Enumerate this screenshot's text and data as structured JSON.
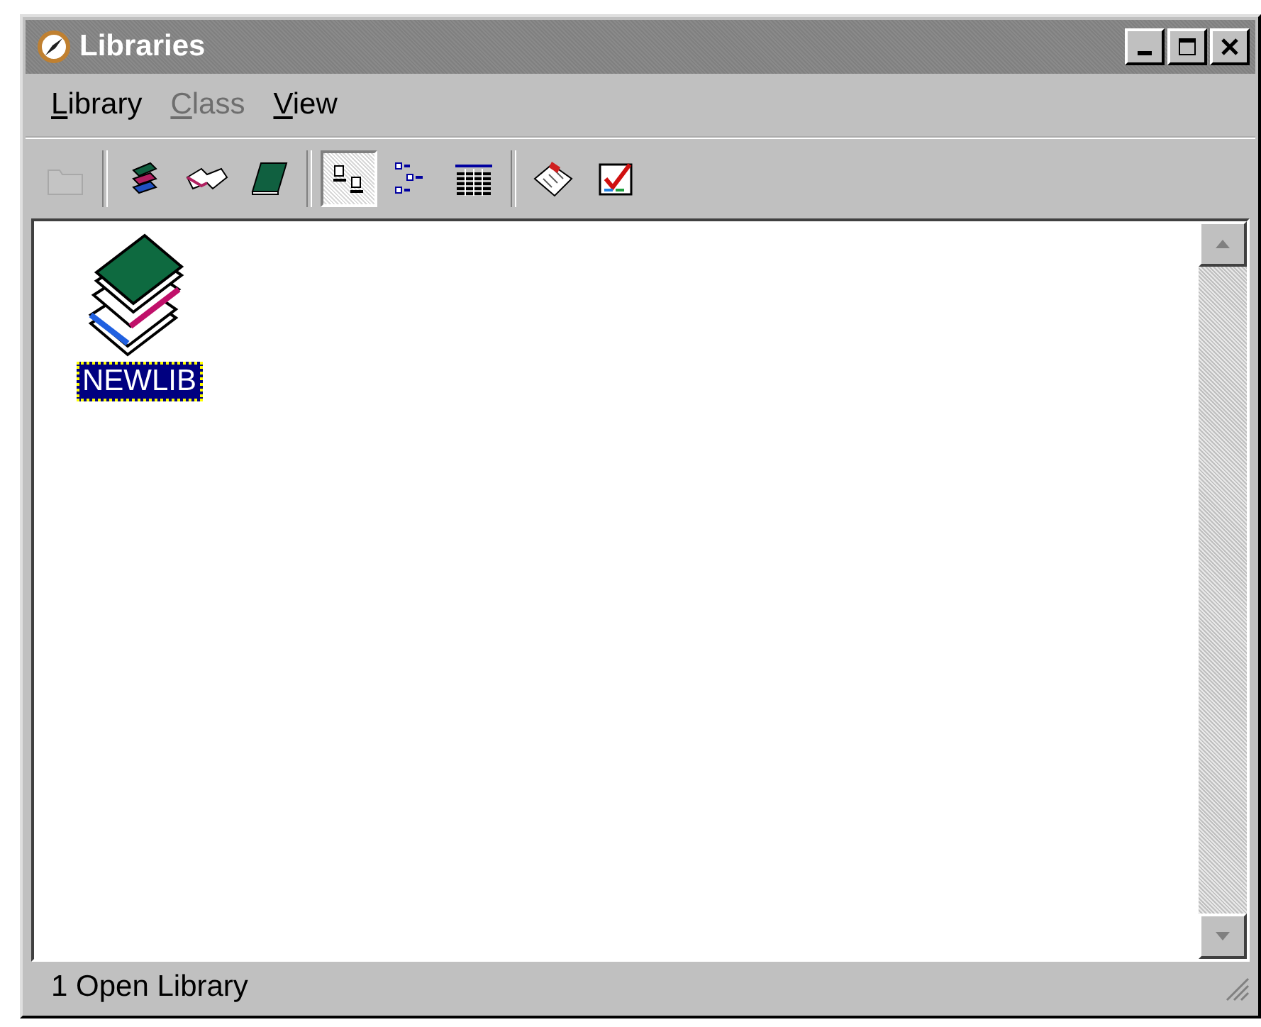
{
  "window": {
    "title": "Libraries"
  },
  "menu": [
    {
      "label": "Library",
      "disabled": false
    },
    {
      "label": "Class",
      "disabled": true
    },
    {
      "label": "View",
      "disabled": false
    }
  ],
  "toolbar": [
    [
      {
        "kind": "folder",
        "disabled": true,
        "pressed": false
      }
    ],
    [
      {
        "kind": "books",
        "disabled": false,
        "pressed": false
      },
      {
        "kind": "open-book",
        "disabled": false,
        "pressed": false
      },
      {
        "kind": "book",
        "disabled": false,
        "pressed": false
      }
    ],
    [
      {
        "kind": "large-icons",
        "disabled": false,
        "pressed": true
      },
      {
        "kind": "tree",
        "disabled": false,
        "pressed": false
      },
      {
        "kind": "details",
        "disabled": false,
        "pressed": false
      }
    ],
    [
      {
        "kind": "notepad",
        "disabled": false,
        "pressed": false
      },
      {
        "kind": "check",
        "disabled": false,
        "pressed": false
      }
    ]
  ],
  "items": [
    {
      "label": "NEWLIB",
      "selected": true
    }
  ],
  "status_bar": "1 Open Library"
}
